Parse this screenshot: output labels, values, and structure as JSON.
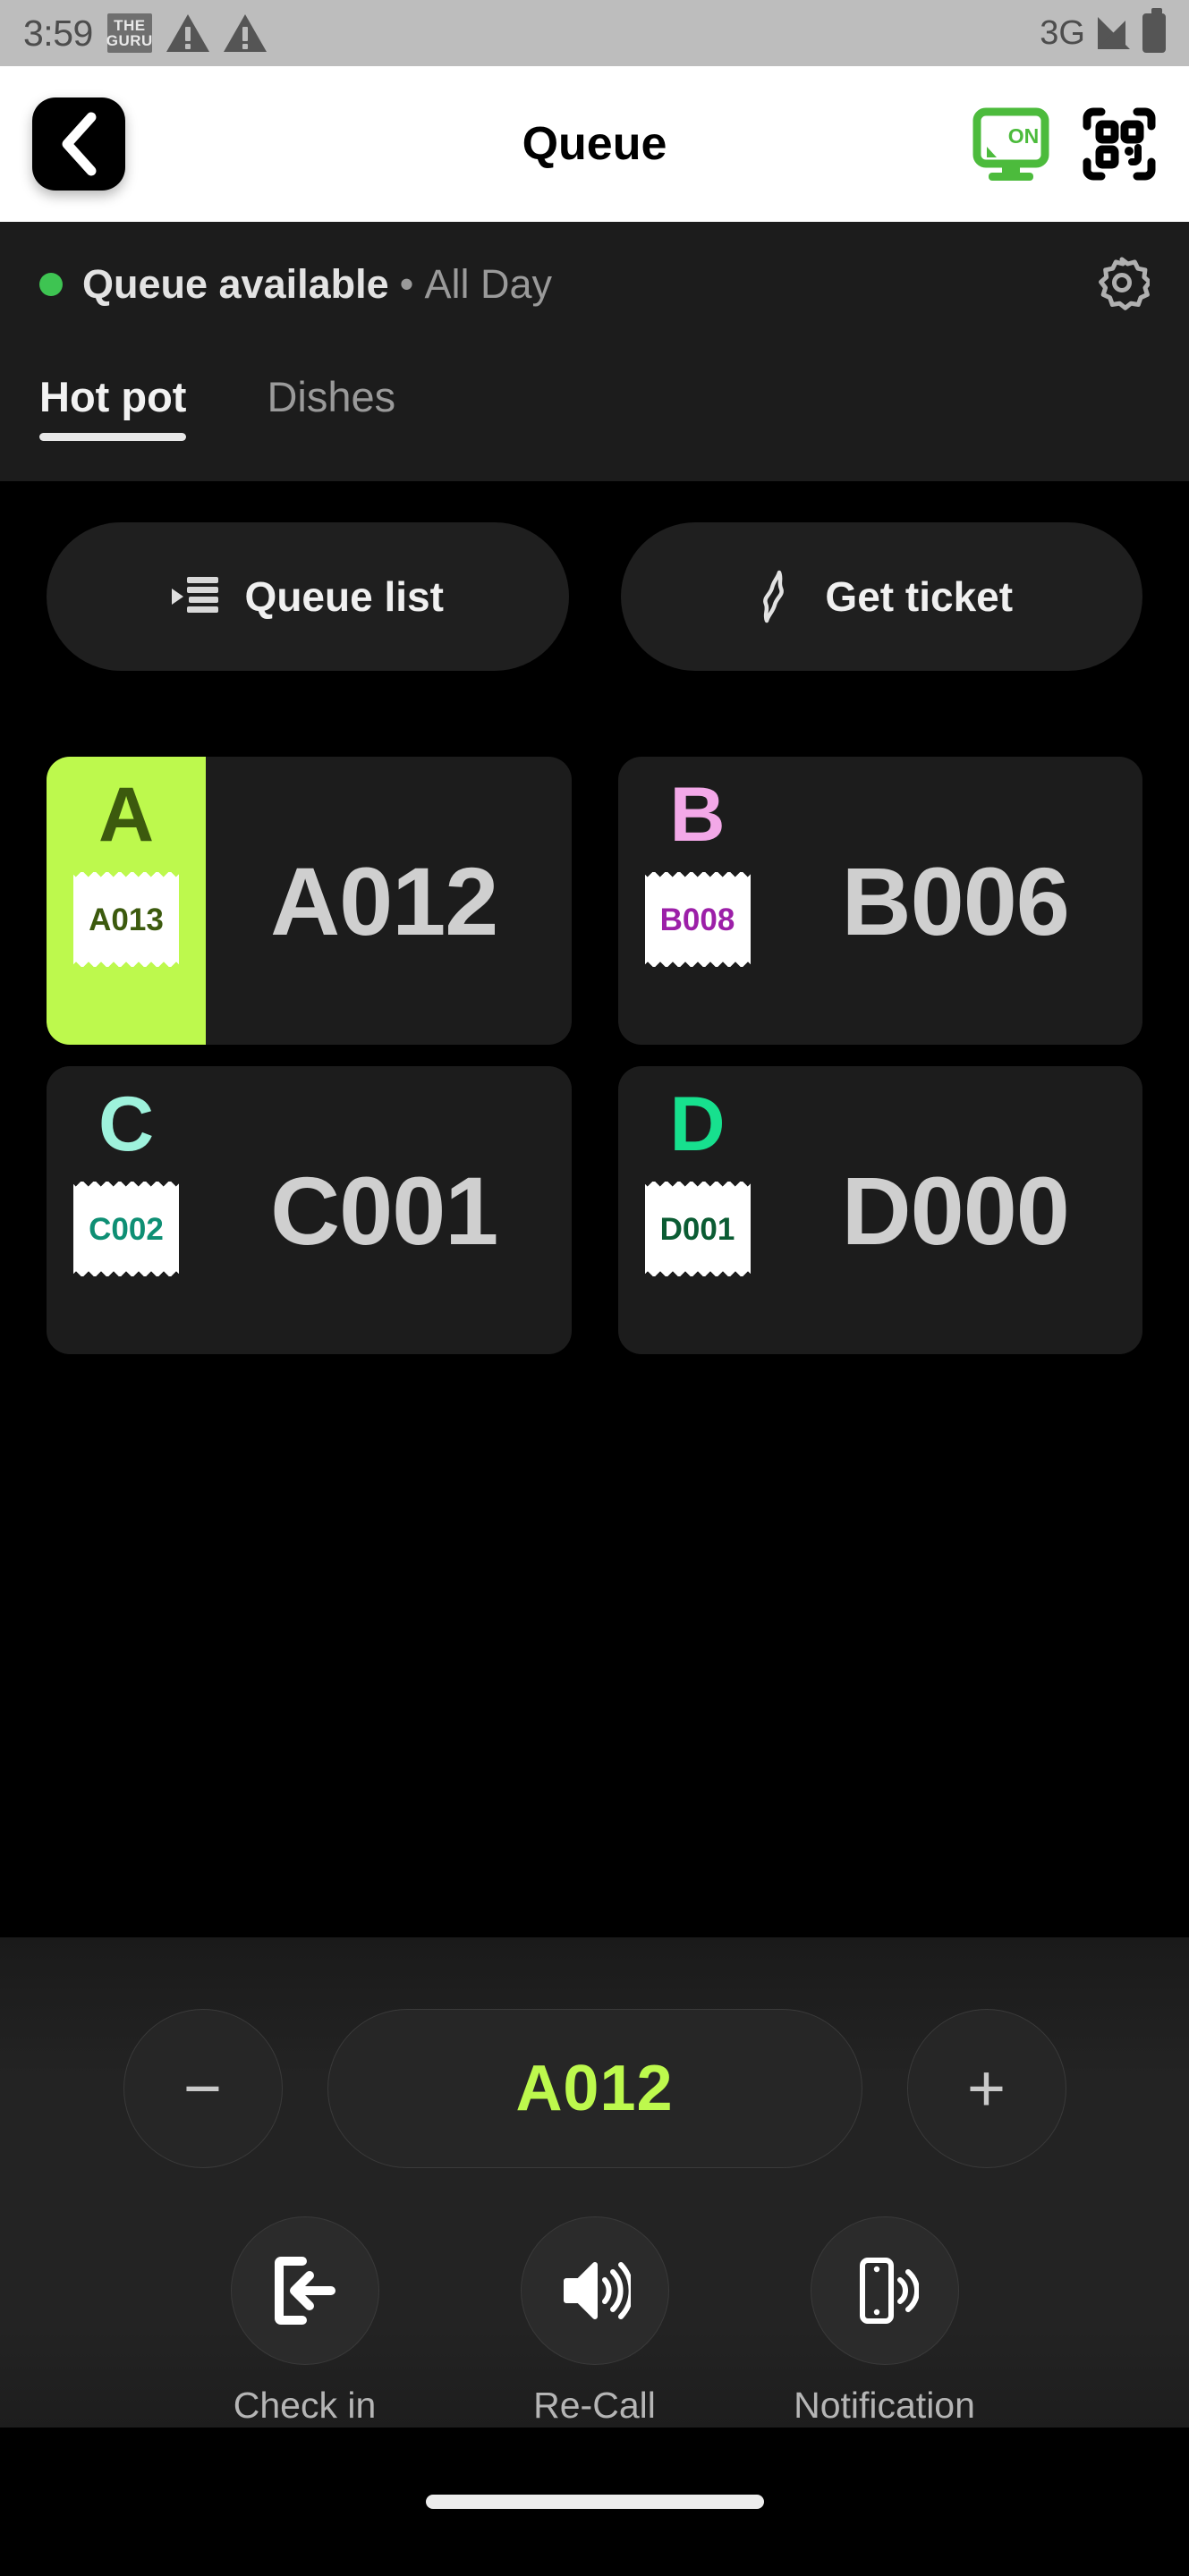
{
  "status_bar": {
    "time": "3:59",
    "app_badge": {
      "line1": "THE",
      "line2": "GURU"
    },
    "warning_icons": [
      "warning-triangle",
      "warning-triangle"
    ],
    "network": "3G",
    "signal_icon": "signal-bars",
    "battery_icon": "battery-full"
  },
  "header": {
    "back_icon": "chevron-left-icon",
    "title": "Queue",
    "display_icon": "monitor-on-icon",
    "display_icon_label": "ON",
    "display_icon_color": "#4CBB3C",
    "qr_icon": "qr-scan-icon"
  },
  "status_row": {
    "dot_color": "#3EC452",
    "available_text": "Queue available",
    "separator": "•",
    "schedule_text": "All Day",
    "settings_icon": "gear-icon"
  },
  "tabs": [
    {
      "label": "Hot pot",
      "active": true
    },
    {
      "label": "Dishes",
      "active": false
    }
  ],
  "toolbar": {
    "queue_list_label": "Queue list",
    "queue_list_icon": "list-play-icon",
    "get_ticket_label": "Get ticket",
    "get_ticket_icon": "ticket-icon"
  },
  "queue_cards": [
    {
      "letter": "A",
      "current": "A012",
      "next_ticket": "A013",
      "selected": true,
      "accent": "#BDF94D",
      "letter_color": "#3C5A0E",
      "ticket_text_color": "#3C5A0E"
    },
    {
      "letter": "B",
      "current": "B006",
      "next_ticket": "B008",
      "selected": false,
      "accent": "#F3A8E8",
      "letter_color": "#F3A8E8",
      "ticket_text_color": "#9C1FA8"
    },
    {
      "letter": "C",
      "current": "C001",
      "next_ticket": "C002",
      "selected": false,
      "accent": "#9EF2DC",
      "letter_color": "#9EF2DC",
      "ticket_text_color": "#0E8F74"
    },
    {
      "letter": "D",
      "current": "D000",
      "next_ticket": "D001",
      "selected": false,
      "accent": "#17E08E",
      "letter_color": "#17E08E",
      "ticket_text_color": "#0B5C33"
    }
  ],
  "controls": {
    "decrement_label": "−",
    "increment_label": "+",
    "current_number": "A012",
    "current_number_color": "#BDF94D"
  },
  "actions": [
    {
      "label": "Check in",
      "icon": "check-in-icon"
    },
    {
      "label": "Re-Call",
      "icon": "speaker-icon"
    },
    {
      "label": "Notification",
      "icon": "phone-vibrate-icon"
    }
  ],
  "gesture_bar": {
    "icon": "home-indicator"
  }
}
